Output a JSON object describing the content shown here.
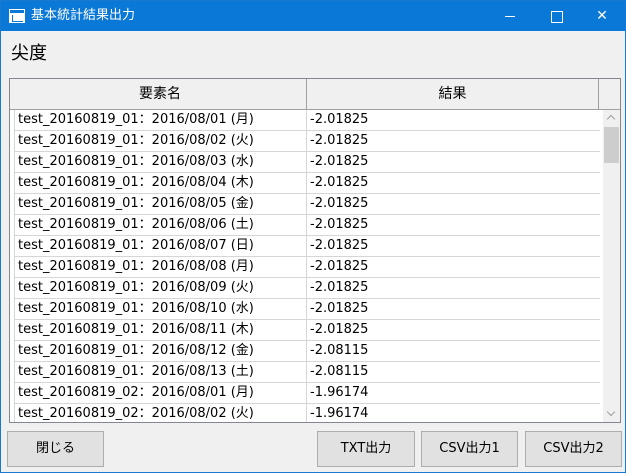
{
  "window": {
    "title": "基本統計結果出力"
  },
  "heading": "尖度",
  "table": {
    "columns": [
      "要素名",
      "結果"
    ],
    "rows": [
      {
        "name": "test_20160819_01：2016/08/01 (月)",
        "result": "-2.01825"
      },
      {
        "name": "test_20160819_01：2016/08/02 (火)",
        "result": "-2.01825"
      },
      {
        "name": "test_20160819_01：2016/08/03 (水)",
        "result": "-2.01825"
      },
      {
        "name": "test_20160819_01：2016/08/04 (木)",
        "result": "-2.01825"
      },
      {
        "name": "test_20160819_01：2016/08/05 (金)",
        "result": "-2.01825"
      },
      {
        "name": "test_20160819_01：2016/08/06 (土)",
        "result": "-2.01825"
      },
      {
        "name": "test_20160819_01：2016/08/07 (日)",
        "result": "-2.01825"
      },
      {
        "name": "test_20160819_01：2016/08/08 (月)",
        "result": "-2.01825"
      },
      {
        "name": "test_20160819_01：2016/08/09 (火)",
        "result": "-2.01825"
      },
      {
        "name": "test_20160819_01：2016/08/10 (水)",
        "result": "-2.01825"
      },
      {
        "name": "test_20160819_01：2016/08/11 (木)",
        "result": "-2.01825"
      },
      {
        "name": "test_20160819_01：2016/08/12 (金)",
        "result": "-2.08115"
      },
      {
        "name": "test_20160819_01：2016/08/13 (土)",
        "result": "-2.08115"
      },
      {
        "name": "test_20160819_02：2016/08/01 (月)",
        "result": "-1.96174"
      },
      {
        "name": "test_20160819_02：2016/08/02 (火)",
        "result": "-1.96174"
      }
    ]
  },
  "buttons": {
    "close": "閉じる",
    "txt": "TXT出力",
    "csv1": "CSV出力1",
    "csv2": "CSV出力2"
  },
  "icons": {
    "app": "window-app-icon",
    "minimize": "minimize-icon",
    "maximize": "maximize-icon",
    "close": "close-icon"
  },
  "colors": {
    "titlebar": "#0a78d7",
    "window_bg": "#f0f0f0"
  }
}
